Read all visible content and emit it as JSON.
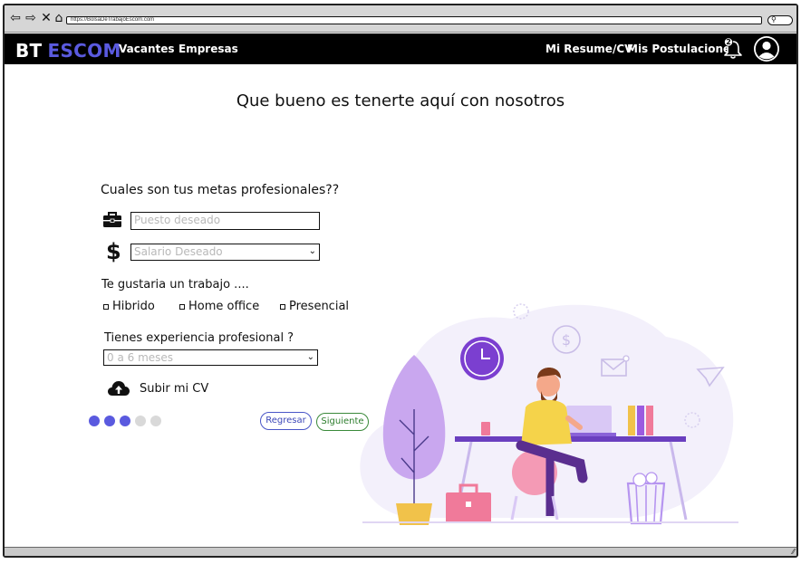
{
  "browser": {
    "url": "https://BolsaDeTrabajoEscom.com"
  },
  "navbar": {
    "brand_bt": "BT",
    "brand_escom": "ESCOM",
    "links": {
      "vacantes": "Vacantes",
      "empresas": "Empresas",
      "resume": "Mi Resume/CV",
      "postulaciones": "Mis Postulaciones"
    },
    "notification_count": "2"
  },
  "main": {
    "welcome": "Que bueno es tenerte aquí con nosotros",
    "question": "Cuales son tus metas profesionales??",
    "position_placeholder": "Puesto deseado",
    "salary_placeholder": "Salario Deseado",
    "work_mode_label": "Te gustaria un trabajo ....",
    "work_modes": [
      "Hibrido",
      "Home office",
      "Presencial"
    ],
    "experience_label": "Tienes experiencia profesional ?",
    "experience_value": "0 a 6 meses",
    "upload_label": "Subir mi CV",
    "back_button": "Regresar",
    "next_button": "Siguiente",
    "progress": {
      "current_step": 3,
      "total_steps": 5
    }
  },
  "icons": {
    "back": "arrow-left-icon",
    "forward": "arrow-right-icon",
    "stop": "close-icon",
    "home": "home-icon",
    "search": "search-icon",
    "bell": "bell-icon",
    "avatar": "user-icon",
    "briefcase": "briefcase-icon",
    "dollar": "dollar-icon",
    "upload": "cloud-upload-icon"
  },
  "colors": {
    "accent": "#5a5adf",
    "navbar_bg": "#000000",
    "dot_active": "#5a5adf",
    "dot_inactive": "#d9d9d9",
    "back_border": "#4a56c8",
    "next_border": "#3a8a3a"
  }
}
